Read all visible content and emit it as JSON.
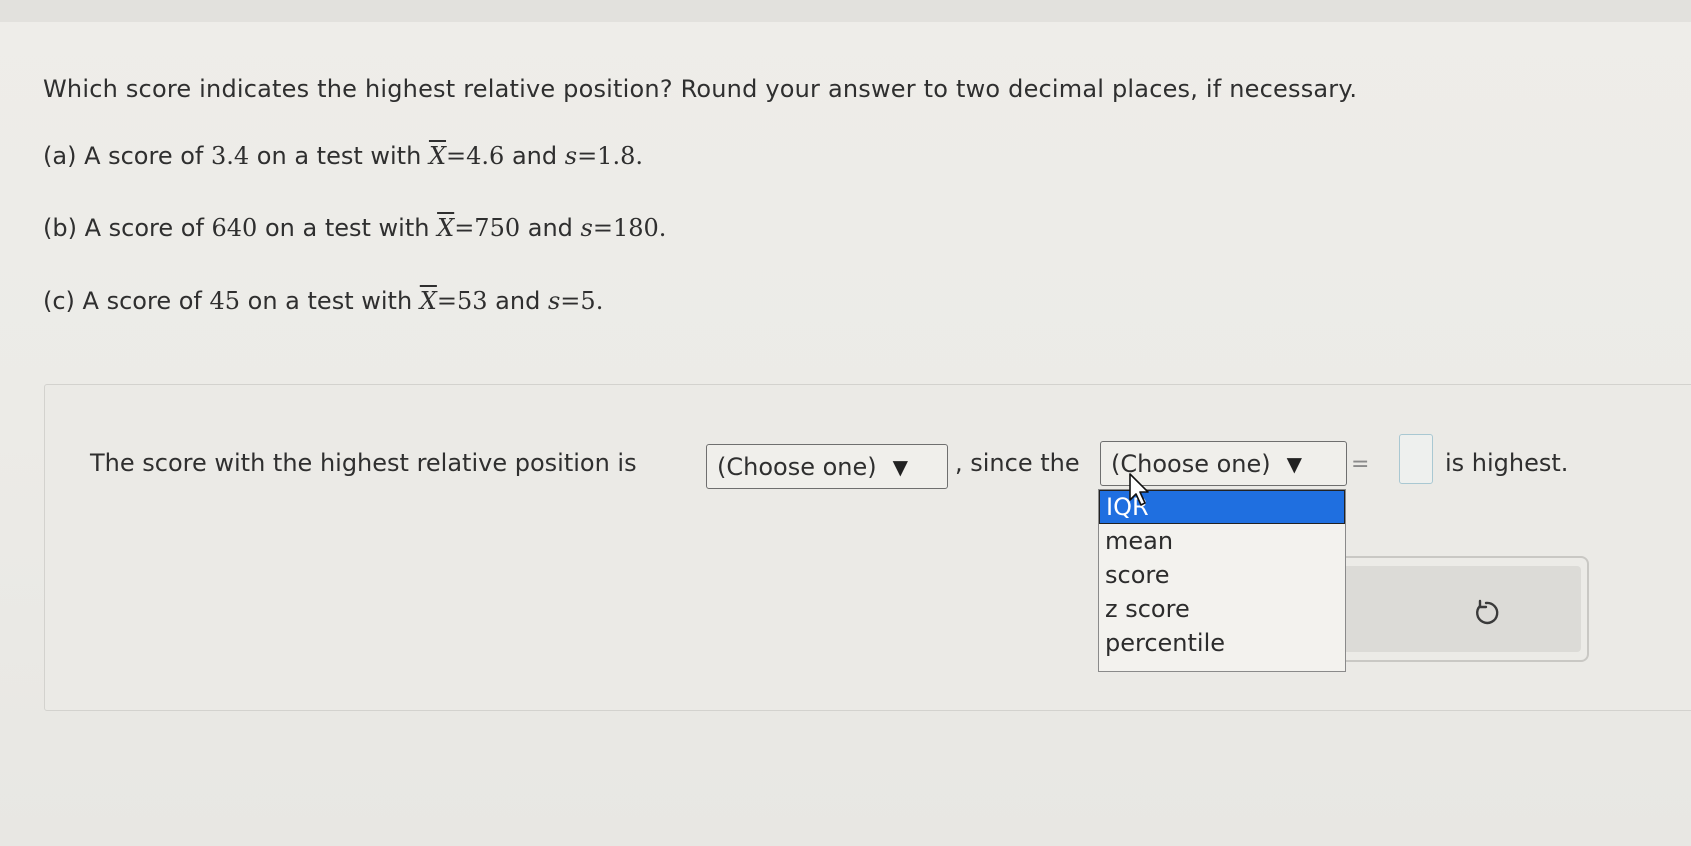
{
  "question": "Which score indicates the highest relative position? Round your answer to two decimal places, if necessary.",
  "parts": {
    "a": {
      "label": "(a) A score of ",
      "score": "3.4",
      "mid": " on a test with ",
      "xbar": "X",
      "eq1": "=4.6",
      "and": " and ",
      "s": "s",
      "eq2": "=1.8",
      "end": "."
    },
    "b": {
      "label": "(b) A score of ",
      "score": "640",
      "mid": " on a test with ",
      "xbar": "X",
      "eq1": "=750",
      "and": " and ",
      "s": "s",
      "eq2": "=180",
      "end": "."
    },
    "c": {
      "label": "(c) A score of ",
      "score": "45",
      "mid": " on a test with ",
      "xbar": "X",
      "eq1": "=53",
      "and": " and ",
      "s": "s",
      "eq2": "=5",
      "end": "."
    }
  },
  "answer": {
    "sentence_start": "The score with the highest relative position is",
    "select1": "(Choose one)",
    "sentence_mid": ", since the",
    "select2": "(Choose one)",
    "equals": "=",
    "sentence_end": "is highest.",
    "arrow": "▼"
  },
  "dropdown": {
    "options": [
      "IQR",
      "mean",
      "score",
      "z score",
      "percentile"
    ],
    "selected_index": 0
  },
  "icons": {
    "reset": "reset-icon",
    "cursor": "mouse-pointer-icon"
  },
  "colors": {
    "selected_bg": "#1f6fe0",
    "input_border": "#a9c8d2"
  }
}
